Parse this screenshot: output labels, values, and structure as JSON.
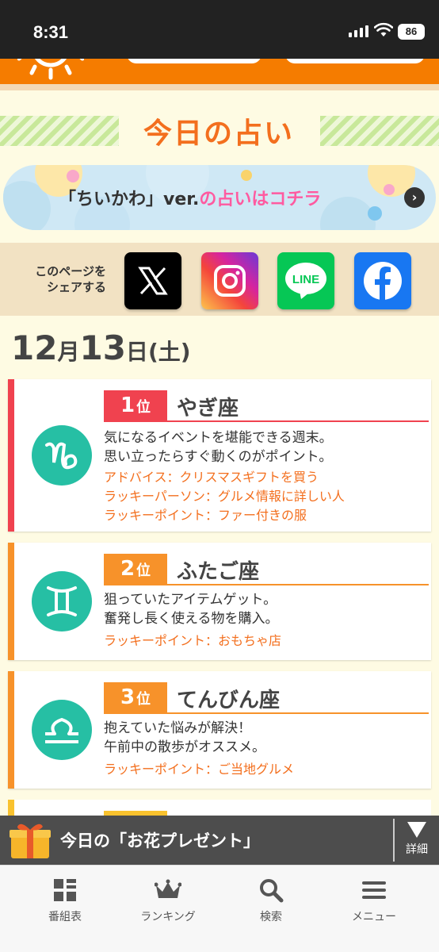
{
  "status_bar": {
    "time": "8:31",
    "battery": "86"
  },
  "page": {
    "section_title": "今日の占い"
  },
  "banner": {
    "text_black": "「ちいかわ」ver.",
    "text_pink": "の占いはコチラ"
  },
  "share": {
    "label_line1": "このページを",
    "label_line2": "シェアする",
    "buttons": [
      {
        "name": "X",
        "color": "#000000"
      },
      {
        "name": "Instagram",
        "color": "#d6249f"
      },
      {
        "name": "LINE",
        "color": "#06c755",
        "text": "LINE"
      },
      {
        "name": "Facebook",
        "color": "#1877f2"
      }
    ]
  },
  "date": {
    "month": "12",
    "month_unit": "月",
    "day": "13",
    "day_unit": "日",
    "weekday": "(土)"
  },
  "rankings": [
    {
      "rank": "1",
      "rank_unit": "位",
      "sign": "やぎ座",
      "symbol": "♑",
      "badge_color": "#f0424f",
      "border_color": "#f0424f",
      "messages": [
        "気になるイベントを堪能できる週末。",
        "思い立ったらすぐ動くのがポイント。"
      ],
      "tips": [
        "アドバイス：クリスマスギフトを買う",
        "ラッキーパーソン：グルメ情報に詳しい人",
        "ラッキーポイント：ファー付きの服"
      ]
    },
    {
      "rank": "2",
      "rank_unit": "位",
      "sign": "ふたご座",
      "symbol": "♊",
      "badge_color": "#f7922a",
      "border_color": "#f7922a",
      "messages": [
        "狙っていたアイテムゲット。",
        "奮発し長く使える物を購入。"
      ],
      "tips": [
        "ラッキーポイント：おもちゃ店"
      ]
    },
    {
      "rank": "3",
      "rank_unit": "位",
      "sign": "てんびん座",
      "symbol": "♎",
      "badge_color": "#f7922a",
      "border_color": "#f7922a",
      "messages": [
        "抱えていた悩みが解決！",
        "午前中の散歩がオススメ。"
      ],
      "tips": [
        "ラッキーポイント：ご当地グルメ"
      ]
    }
  ],
  "gift_bar": {
    "text": "今日の「お花プレゼント」",
    "detail_label": "詳細"
  },
  "bottom_nav": [
    {
      "label": "番組表",
      "icon": "grid-icon"
    },
    {
      "label": "ランキング",
      "icon": "crown-icon"
    },
    {
      "label": "検索",
      "icon": "search-icon"
    },
    {
      "label": "メニュー",
      "icon": "hamburger-icon"
    }
  ]
}
